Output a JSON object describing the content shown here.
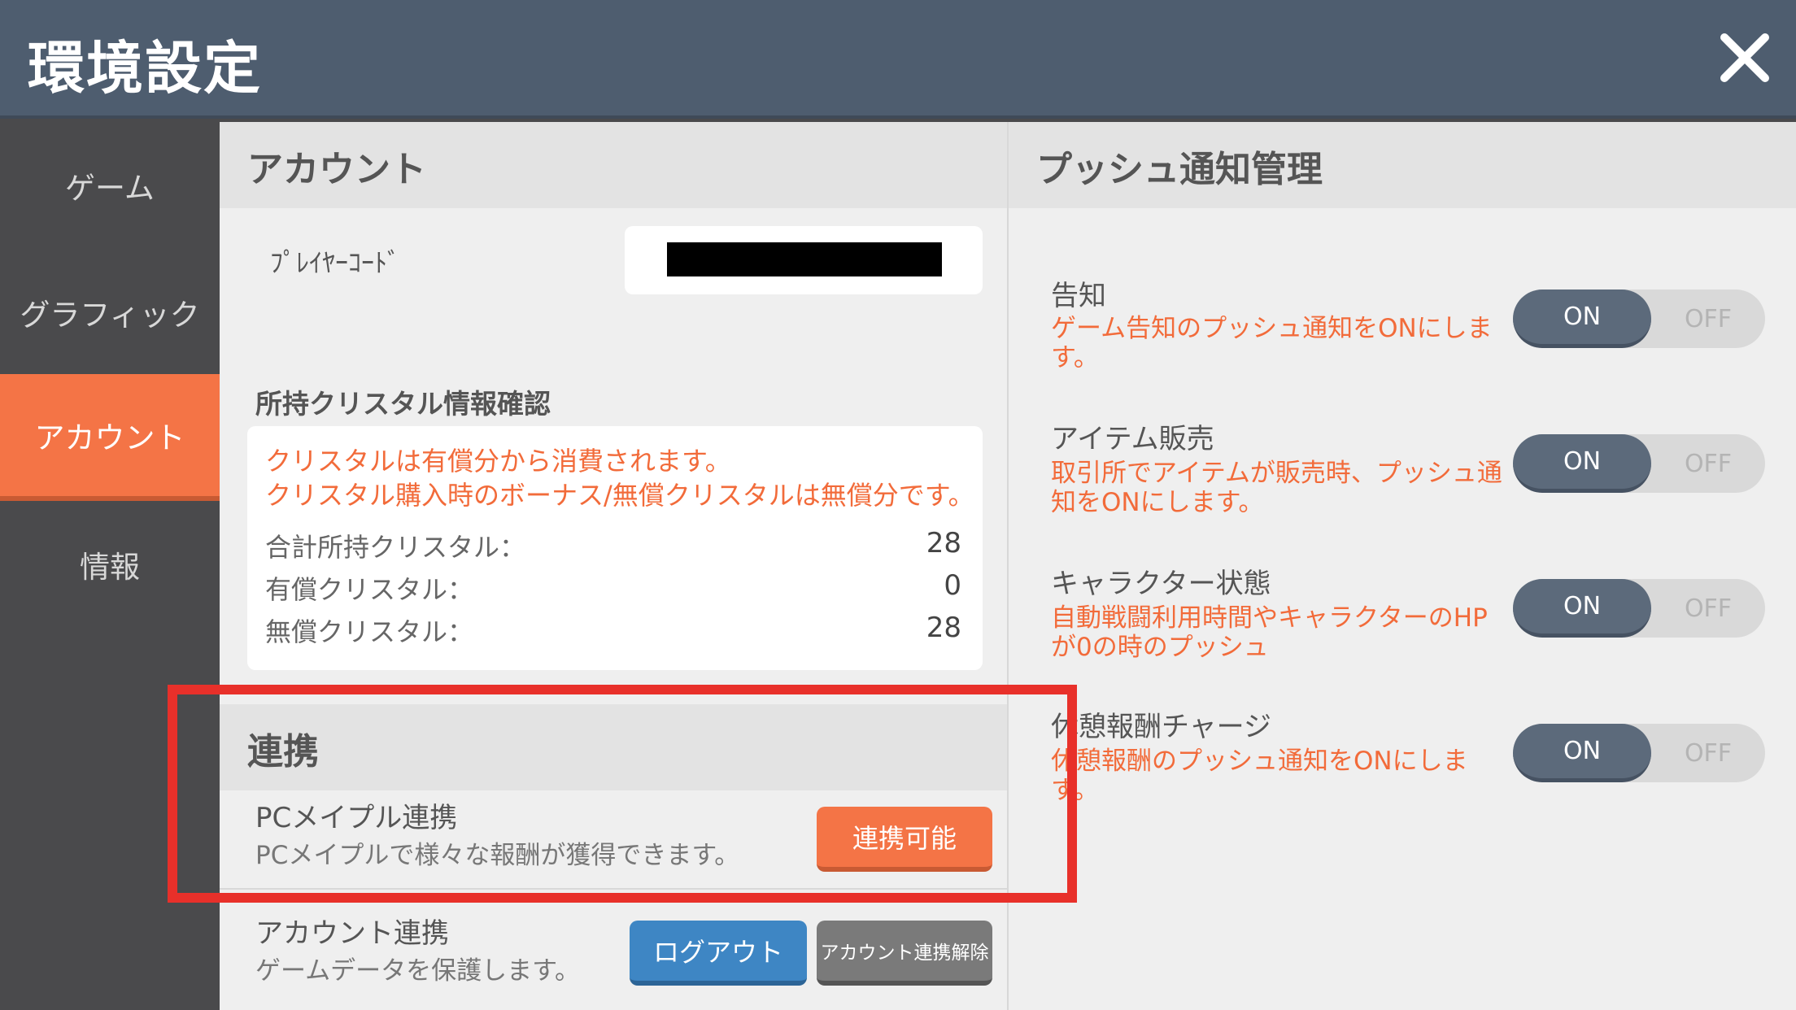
{
  "header": {
    "title": "環境設定",
    "close_icon": "close-icon"
  },
  "sidebar": {
    "items": [
      {
        "label": "ゲーム",
        "active": false
      },
      {
        "label": "グラフィック",
        "active": false
      },
      {
        "label": "アカウント",
        "active": true
      },
      {
        "label": "情報",
        "active": false
      }
    ]
  },
  "account": {
    "heading": "アカウント",
    "player_code_label": "ﾌﾟﾚｲﾔｰｺｰﾄﾞ",
    "crystal": {
      "heading": "所持クリスタル情報確認",
      "notes": [
        "クリスタルは有償分から消費されます。",
        "クリスタル購入時のボーナス/無償クリスタルは無償分です。"
      ],
      "rows": [
        {
          "label": "合計所持クリスタル：",
          "value": "28"
        },
        {
          "label": "有償クリスタル：",
          "value": "0"
        },
        {
          "label": "無償クリスタル：",
          "value": "28"
        }
      ]
    }
  },
  "linking": {
    "heading": "連携",
    "pc": {
      "title": "PCメイプル連携",
      "desc": "PCメイプルで様々な報酬が獲得できます。",
      "button": "連携可能"
    },
    "account_link": {
      "title": "アカウント連携",
      "desc": "ゲームデータを保護します。",
      "logout": "ログアウト",
      "unlink": "アカウント連携解除"
    }
  },
  "push": {
    "heading": "プッシュ通知管理",
    "items": [
      {
        "title": "告知",
        "desc": "ゲーム告知のプッシュ通知をONにします。",
        "state": "ON"
      },
      {
        "title": "アイテム販売",
        "desc": "取引所でアイテムが販売時、プッシュ通知をONにします。",
        "state": "ON"
      },
      {
        "title": "キャラクター状態",
        "desc": "自動戦闘利用時間やキャラクターのHPが0の時のプッシュ",
        "state": "ON"
      },
      {
        "title": "休憩報酬チャージ",
        "desc": "休憩報酬のプッシュ通知をONにします。",
        "state": "ON"
      }
    ],
    "on_label": "ON",
    "off_label": "OFF"
  },
  "colors": {
    "header_bg": "#4e5d6f",
    "accent_orange": "#f47446",
    "highlight_red": "#e8302a",
    "logout_blue": "#3e86c4"
  }
}
